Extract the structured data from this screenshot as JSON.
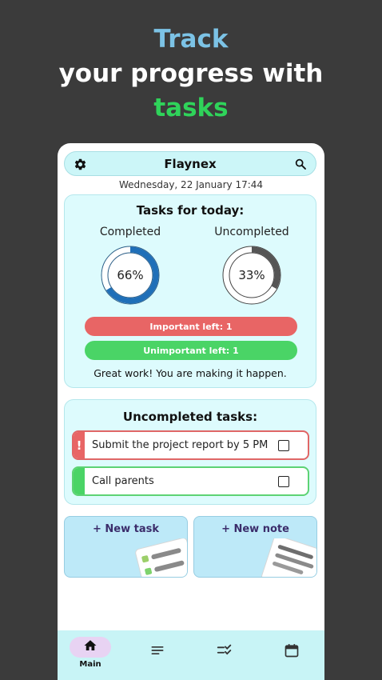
{
  "promo": {
    "line1": "Track",
    "line2": "your progress with",
    "line3": "tasks"
  },
  "colors": {
    "accent_blue": "#7cc3e6",
    "accent_green": "#2fd35a",
    "important_red": "#e86565",
    "unimportant_green": "#4ad466",
    "progress_blue": "#1f6fb8",
    "progress_gray": "#555555"
  },
  "app": {
    "title": "Flaynex",
    "settings_icon": "gear-icon",
    "search_icon": "search-icon",
    "datetime": "Wednesday, 22 January 17:44"
  },
  "today": {
    "title": "Tasks for today:",
    "completed_label": "Completed",
    "completed_pct_text": "66%",
    "completed_fraction": 0.66,
    "uncompleted_label": "Uncompleted",
    "uncompleted_pct_text": "33%",
    "uncompleted_fraction": 0.33,
    "important_left": "Important left: 1",
    "unimportant_left": "Unimportant left: 1",
    "message": "Great work! You are making it happen."
  },
  "uncompleted": {
    "title": "Uncompleted tasks:",
    "important_marker": "!",
    "tasks": [
      {
        "text": "Submit the project report by 5 PM",
        "important": true,
        "done": false
      },
      {
        "text": "Call parents",
        "important": false,
        "done": false
      }
    ]
  },
  "actions": {
    "new_task": "+ New task",
    "new_note": "+ New note"
  },
  "nav": {
    "items": [
      {
        "icon": "home-icon",
        "label": "Main",
        "active": true
      },
      {
        "icon": "notes-list-icon"
      },
      {
        "icon": "task-checklist-icon"
      },
      {
        "icon": "calendar-icon"
      }
    ]
  }
}
